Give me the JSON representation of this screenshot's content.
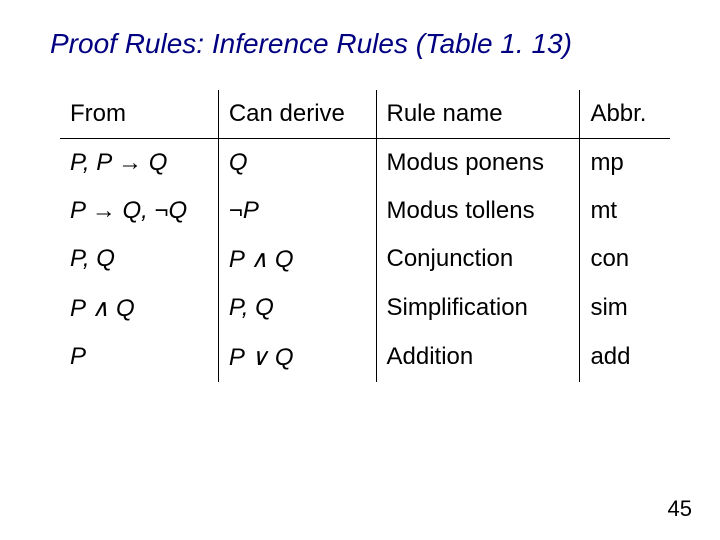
{
  "title": "Proof Rules: Inference Rules (Table 1. 13)",
  "headers": {
    "from": "From",
    "derive": "Can derive",
    "name": "Rule name",
    "abbr": "Abbr."
  },
  "rows": [
    {
      "from": "P,  P → Q",
      "derive": "Q",
      "name": "Modus ponens",
      "abbr": "mp"
    },
    {
      "from": "P → Q,  ¬Q",
      "derive": "¬P",
      "name": "Modus tollens",
      "abbr": "mt"
    },
    {
      "from": "P,  Q",
      "derive": "P ∧ Q",
      "name": "Conjunction",
      "abbr": "con"
    },
    {
      "from": "P ∧ Q",
      "derive": "P,  Q",
      "name": "Simplification",
      "abbr": "sim"
    },
    {
      "from": "P",
      "derive": "P ∨ Q",
      "name": "Addition",
      "abbr": "add"
    }
  ],
  "page_number": "45",
  "chart_data": {
    "type": "table",
    "title": "Proof Rules: Inference Rules (Table 1.13)",
    "columns": [
      "From",
      "Can derive",
      "Rule name",
      "Abbr."
    ],
    "rows": [
      [
        "P, P → Q",
        "Q",
        "Modus ponens",
        "mp"
      ],
      [
        "P → Q, ¬Q",
        "¬P",
        "Modus tollens",
        "mt"
      ],
      [
        "P, Q",
        "P ∧ Q",
        "Conjunction",
        "con"
      ],
      [
        "P ∧ Q",
        "P, Q",
        "Simplification",
        "sim"
      ],
      [
        "P",
        "P ∨ Q",
        "Addition",
        "add"
      ]
    ]
  }
}
